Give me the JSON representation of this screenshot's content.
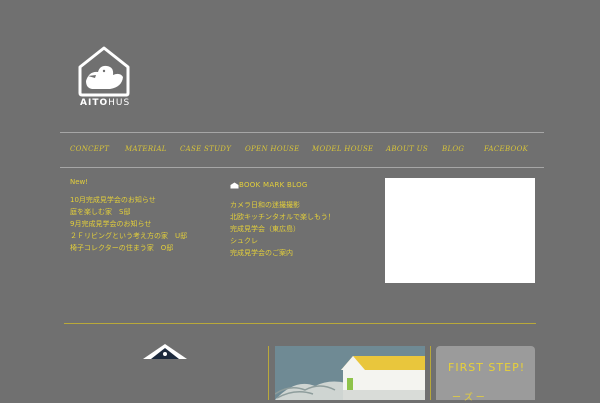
{
  "brand": {
    "name_bold": "AITO",
    "name_rest": "HUS"
  },
  "nav": [
    {
      "label": "CONCEPT"
    },
    {
      "label": "MATERIAL"
    },
    {
      "label": "CASE STUDY"
    },
    {
      "label": "OPEN HOUSE"
    },
    {
      "label": "MODEL HOUSE"
    },
    {
      "label": "ABOUT US"
    },
    {
      "label": "BLOG"
    },
    {
      "label": "FACEBOOK"
    }
  ],
  "news": {
    "heading": "New!",
    "items": [
      "10月完成見学会のお知らせ",
      "庭を楽しむ家　S邸",
      "9月完成見学会のお知らせ",
      "２Ｆリビングという考え方の家　U邸",
      "椅子コレクターの住まう家　O邸"
    ]
  },
  "blog": {
    "heading": "BOOK MARK BLOG",
    "items": [
      "カメラ日和の迷撮撮影",
      "北欧キッチンタオルで楽しもう！",
      "完成見学会（東広島）",
      "シュクレ",
      "完成見学会のご案内"
    ]
  },
  "first_step": {
    "title": "FIRST STEP!",
    "sub": "ー ズ ー"
  },
  "colors": {
    "background": "#707070",
    "accent": "#e3cf3a",
    "rule": "#a6a6a6"
  }
}
